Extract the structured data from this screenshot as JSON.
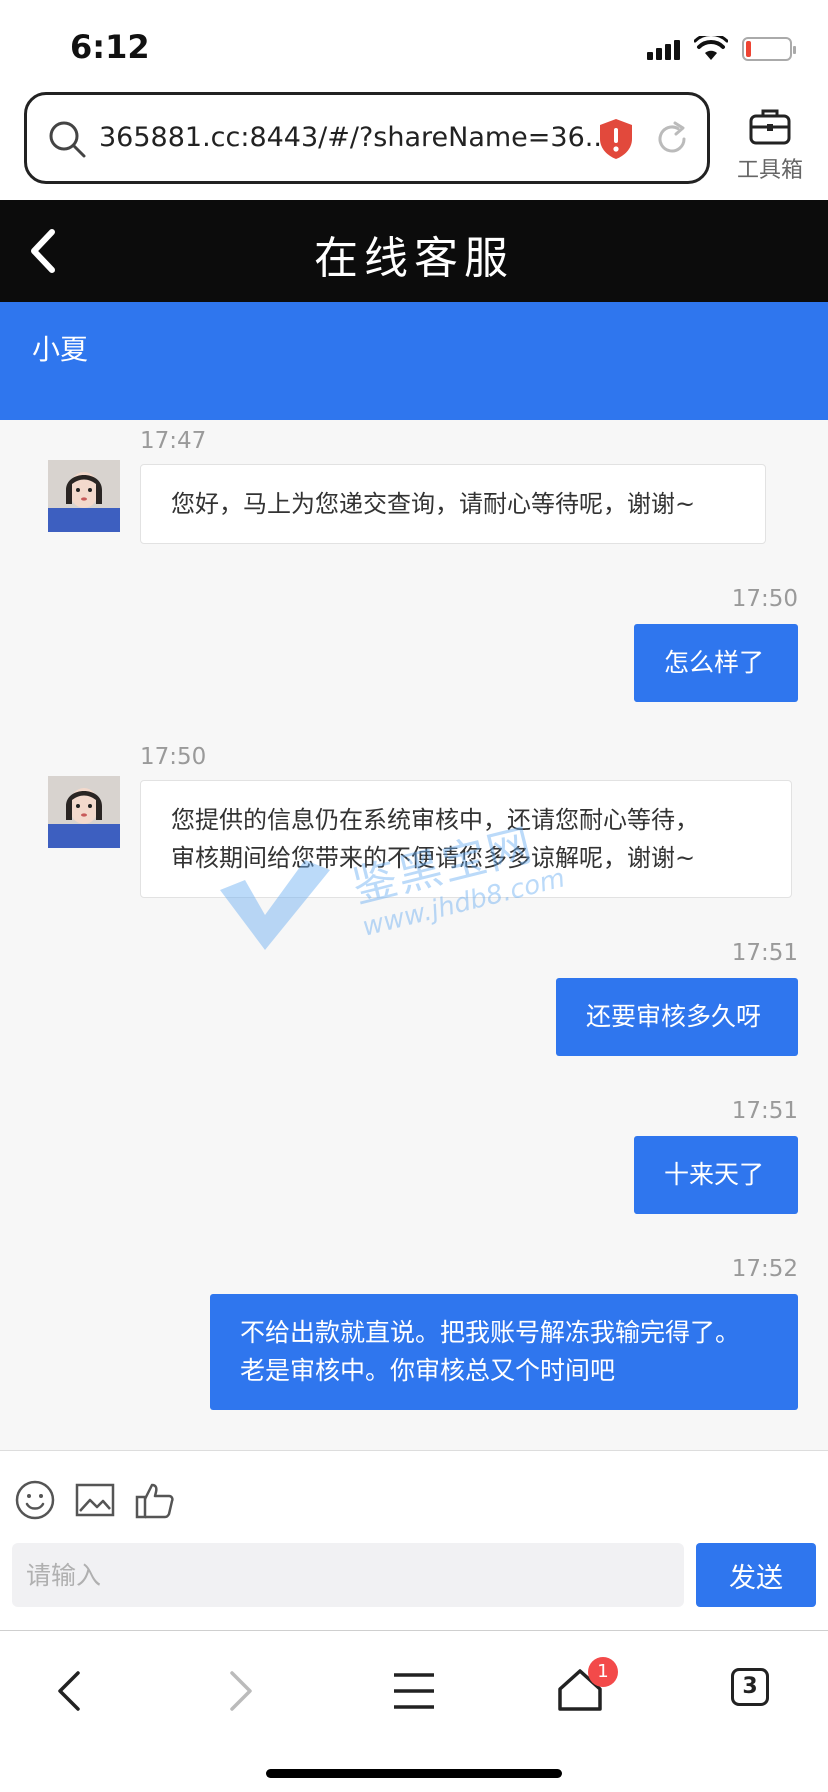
{
  "status_bar": {
    "time": "6:12"
  },
  "browser": {
    "url": "365881.cc:8443/#/?shareName=36...",
    "toolbox_label": "工具箱"
  },
  "header": {
    "title": "在线客服"
  },
  "agent": {
    "name": "小夏"
  },
  "messages": [
    {
      "side": "incoming",
      "time": "17:47",
      "lines": [
        "您好，马上为您递交查询，请耐心等待呢，谢谢~"
      ]
    },
    {
      "side": "outgoing",
      "time": "17:50",
      "lines": [
        "怎么样了"
      ]
    },
    {
      "side": "incoming",
      "time": "17:50",
      "lines": [
        "您提供的信息仍在系统审核中，还请您耐心等待，",
        "审核期间给您带来的不便请您多多谅解呢，谢谢~"
      ]
    },
    {
      "side": "outgoing",
      "time": "17:51",
      "lines": [
        "还要审核多久呀"
      ]
    },
    {
      "side": "outgoing",
      "time": "17:51",
      "lines": [
        "十来天了"
      ]
    },
    {
      "side": "outgoing",
      "time": "17:52",
      "lines": [
        "不给出款就直说。把我账号解冻我输完得了。",
        "老是审核中。你审核总又个时间吧"
      ]
    }
  ],
  "watermark": {
    "text": "鉴黑宝网",
    "url": "www.jhdb8.com"
  },
  "input": {
    "placeholder": "请输入",
    "value": "",
    "send_label": "发送"
  },
  "bottom_nav": {
    "home_badge": "1",
    "tabs_count": "3"
  },
  "colors": {
    "accent": "#2f76ee",
    "header_bg": "#0c0c0c",
    "chat_bg": "#f7f7f7",
    "badge": "#f34a4a"
  }
}
